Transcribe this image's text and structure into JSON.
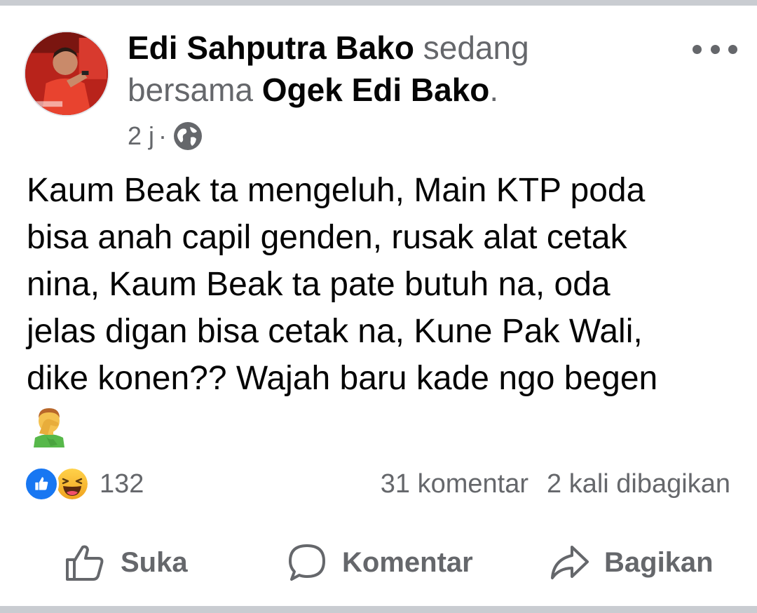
{
  "post": {
    "author": "Edi Sahputra Bako",
    "with_text_1": "sedang",
    "with_text_2": "bersama",
    "tagged": "Ogek Edi Bako",
    "period": ".",
    "time": "2 j",
    "meta_separator": "·",
    "privacy_icon": "globe-icon",
    "body_lines": [
      "Kaum Beak ta mengeluh, Main KTP poda",
      "bisa anah capil genden, rusak alat cetak",
      "nina, Kaum Beak ta pate butuh na, oda",
      "jelas digan bisa cetak na, Kune Pak Wali,",
      "dike konen?? Wajah baru kade ngo begen"
    ],
    "body_emoji": "man-facepalming-emoji"
  },
  "stats": {
    "reaction_icons": [
      "like-icon",
      "haha-icon"
    ],
    "reaction_count": "132",
    "comments": "31 komentar",
    "shares": "2 kali dibagikan"
  },
  "actions": {
    "like_label": "Suka",
    "comment_label": "Komentar",
    "share_label": "Bagikan"
  },
  "colors": {
    "primary_text": "#050505",
    "secondary_text": "#65676b",
    "like_blue": "#1877f2",
    "divider": "#c9ccd1"
  }
}
